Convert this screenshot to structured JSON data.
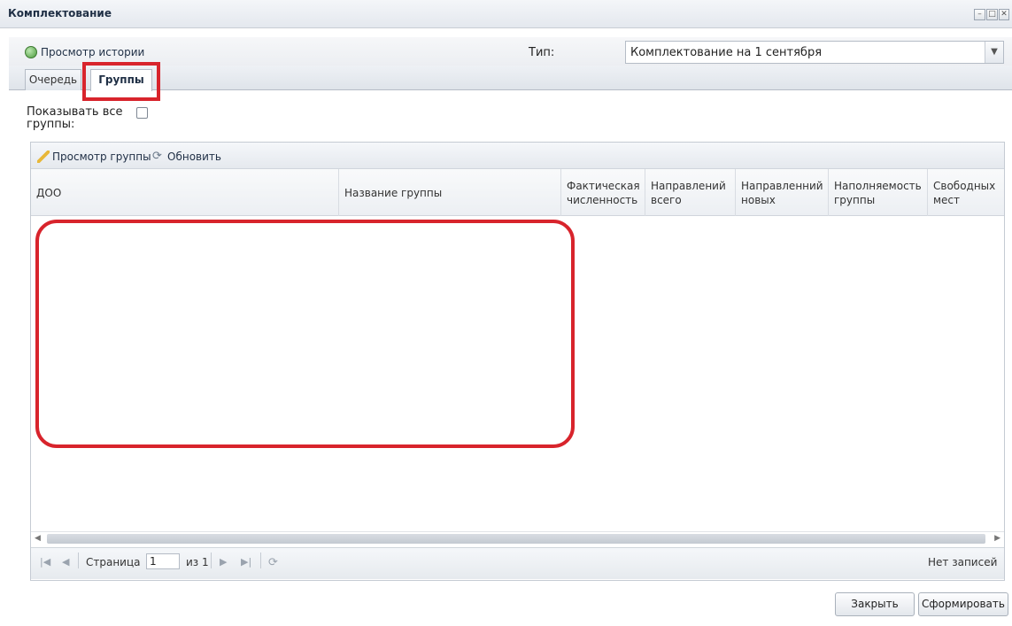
{
  "window": {
    "title": "Комплектование",
    "controls": [
      "minimize",
      "maximize",
      "close"
    ]
  },
  "toolbar": {
    "history_label": "Просмотр истории",
    "type_label": "Тип:",
    "type_value": "Комплектование на 1 сентября"
  },
  "tabs": [
    {
      "label": "Очередь",
      "active": false
    },
    {
      "label": "Группы",
      "active": true
    }
  ],
  "filters": {
    "show_all_label": "Показывать все группы:",
    "show_all_checked": false
  },
  "grid_toolbar": {
    "view_group_label": "Просмотр группы",
    "refresh_label": "Обновить"
  },
  "columns": [
    "ДОО",
    "Название группы",
    "Фактическая численность",
    "Направлений всего",
    "Направленний новых",
    "Наполняемость группы",
    "Свободных мест"
  ],
  "rows": [],
  "pager": {
    "page_label": "Страница",
    "page_value": "1",
    "of_label": "из 1",
    "status": "Нет записей"
  },
  "buttons": {
    "close_label": "Закрыть",
    "submit_label": "Сформировать"
  },
  "colors": {
    "highlight": "#d8242c",
    "title_text": "#1f2f45"
  }
}
